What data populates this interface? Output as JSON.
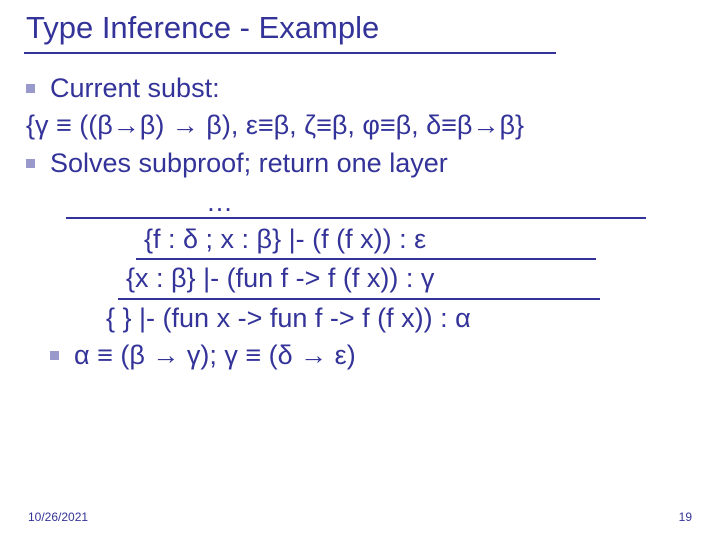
{
  "title": "Type Inference - Example",
  "bullets": {
    "b1": "Current subst:",
    "subst": "{γ ≡ ((β→β) → β), ε≡β, ζ≡β, φ≡β, δ≡β→β}",
    "b2": "Solves subproof; return one layer"
  },
  "proof": {
    "dots": "…",
    "line1": "{f : δ ; x : β} |- (f (f x)) : ε",
    "line2": "{x : β} |- (fun f -> f (f x)) : γ",
    "line3": "{ } |- (fun x -> fun f -> f (f x)) : α",
    "line4": "α ≡ (β → γ); γ ≡ (δ → ε)"
  },
  "footer": {
    "date": "10/26/2021",
    "page": "19"
  },
  "chart_data": {
    "type": "table",
    "title": "Type Inference - Example (presentation slide)",
    "content": {
      "current_substitution": "{γ ≡ ((β→β) → β), ε≡β, ζ≡β, φ≡β, δ≡β→β}",
      "note": "Solves subproof; return one layer",
      "derivation": [
        "{f : δ ; x : β} |- (f (f x)) : ε",
        "{x : β} |- (fun f -> f (f x)) : γ",
        "{ } |- (fun x -> fun f -> f (f x)) : α"
      ],
      "constraints": "α ≡ (β → γ); γ ≡ (δ → ε)"
    }
  }
}
